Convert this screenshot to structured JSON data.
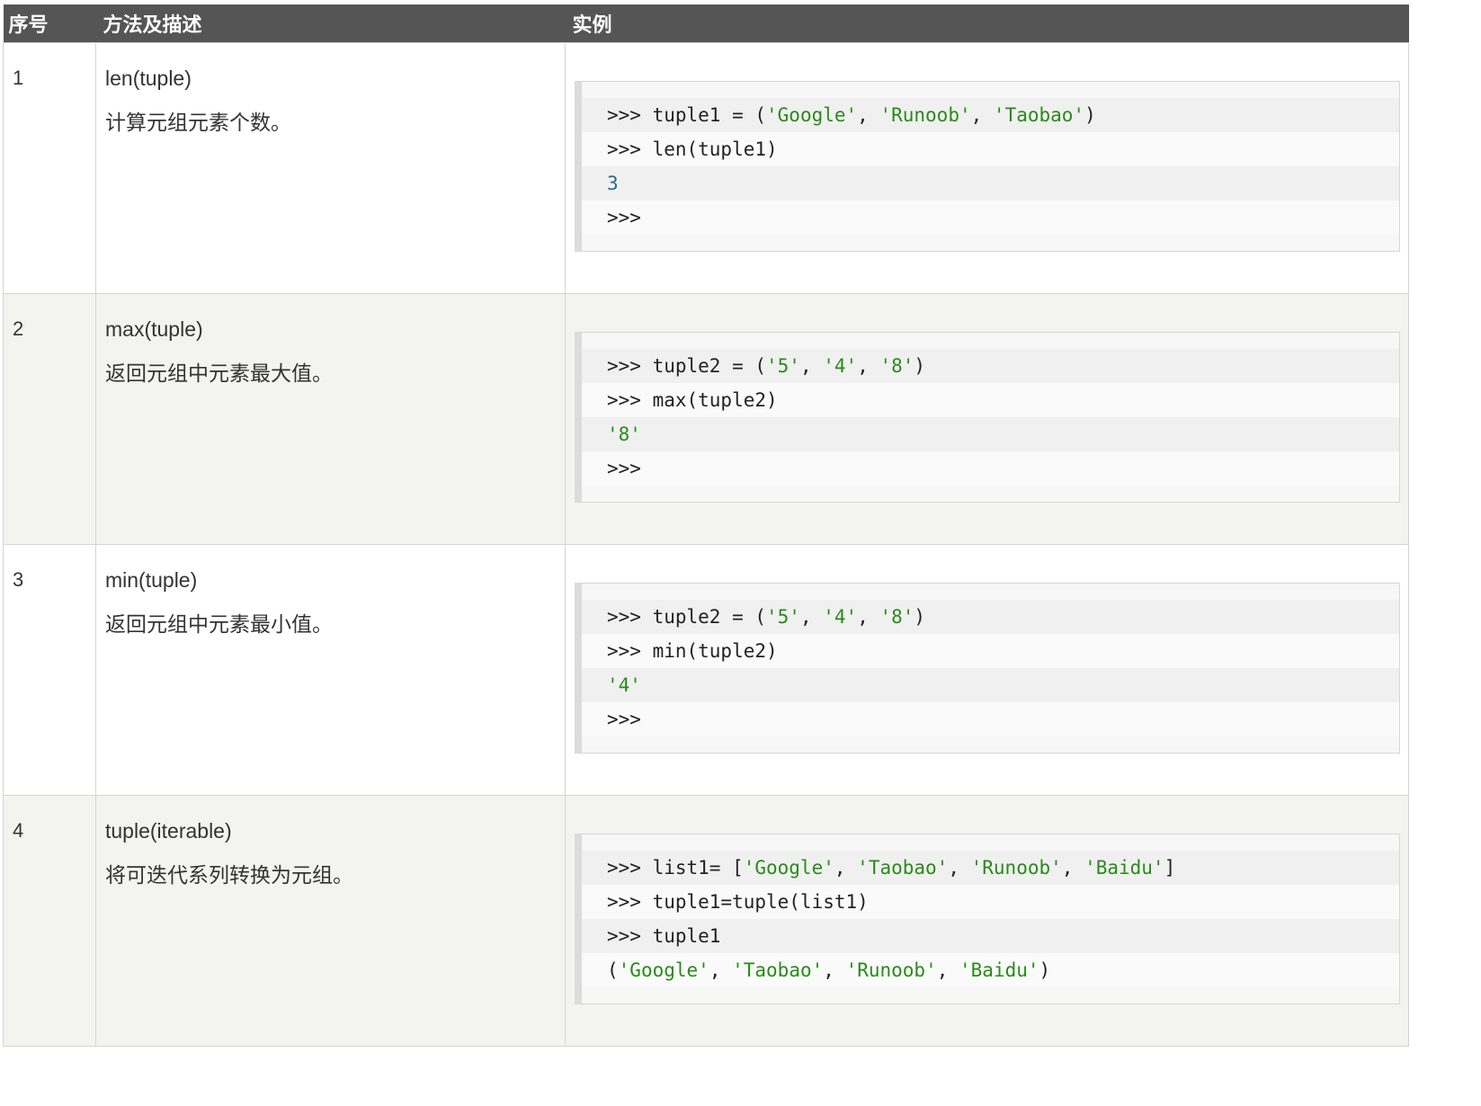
{
  "header": {
    "col_index": "序号",
    "col_method": "方法及描述",
    "col_example": "实例"
  },
  "rows": [
    {
      "index": "1",
      "method": "len(tuple)",
      "description": "计算元组元素个数。",
      "code": [
        ">>> tuple1 = ('Google', 'Runoob', 'Taobao')",
        ">>> len(tuple1)",
        "3",
        ">>>"
      ]
    },
    {
      "index": "2",
      "method": "max(tuple)",
      "description": "返回元组中元素最大值。",
      "code": [
        ">>> tuple2 = ('5', '4', '8')",
        ">>> max(tuple2)",
        "'8'",
        ">>>"
      ]
    },
    {
      "index": "3",
      "method": "min(tuple)",
      "description": "返回元组中元素最小值。",
      "code": [
        ">>> tuple2 = ('5', '4', '8')",
        ">>> min(tuple2)",
        "'4'",
        ">>>"
      ]
    },
    {
      "index": "4",
      "method": "tuple(iterable)",
      "description": "将可迭代系列转换为元组。",
      "code": [
        ">>> list1= ['Google', 'Taobao', 'Runoob', 'Baidu']",
        ">>> tuple1=tuple(list1)",
        ">>> tuple1",
        "('Google', 'Taobao', 'Runoob', 'Baidu')"
      ]
    }
  ],
  "colors": {
    "header_bg": "#555555",
    "header_text": "#ffffff",
    "row_alt_bg": "#f3f3f0",
    "string_color": "#2a8a1a",
    "number_color": "#2a6a8a"
  }
}
